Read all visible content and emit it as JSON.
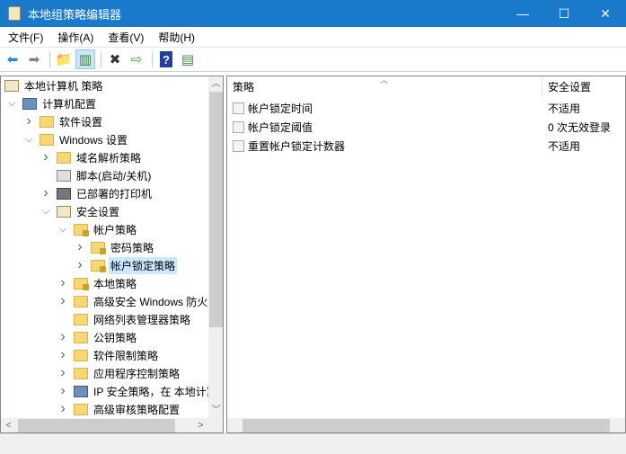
{
  "window": {
    "title": "本地组策略编辑器",
    "minimize": "—",
    "maximize": "☐",
    "close": "✕"
  },
  "menu": [
    "文件(F)",
    "操作(A)",
    "查看(V)",
    "帮助(H)"
  ],
  "toolbar": [
    {
      "name": "back-icon",
      "glyph": "⬅",
      "color": "#2b88d8"
    },
    {
      "name": "forward-icon",
      "glyph": "➡",
      "color": "#808080"
    },
    {
      "sep": true
    },
    {
      "name": "up-folder-icon",
      "glyph": "📁",
      "color": "#d8a030"
    },
    {
      "name": "show-hide-tree-icon",
      "glyph": "▥",
      "color": "#3a8a3a",
      "selected": true
    },
    {
      "sep": true
    },
    {
      "name": "delete-icon",
      "glyph": "✖",
      "color": "#333"
    },
    {
      "name": "export-list-icon",
      "glyph": "⇨",
      "color": "#3a9a3a"
    },
    {
      "sep": true
    },
    {
      "name": "help-icon",
      "glyph": "?",
      "color": "#2040a0"
    },
    {
      "name": "action-pane-icon",
      "glyph": "▤",
      "color": "#3a8a3a"
    }
  ],
  "tree": [
    {
      "label": "本地计算机 策略",
      "level": 0,
      "arrow": "",
      "icon": "doc"
    },
    {
      "label": "计算机配置",
      "level": 1,
      "arrow": "expanded",
      "icon": "comp"
    },
    {
      "label": "软件设置",
      "level": 2,
      "arrow": "collapsed",
      "icon": "folder"
    },
    {
      "label": "Windows 设置",
      "level": 2,
      "arrow": "expanded",
      "icon": "folder"
    },
    {
      "label": "域名解析策略",
      "level": 3,
      "arrow": "collapsed",
      "icon": "folder"
    },
    {
      "label": "脚本(启动/关机)",
      "level": 3,
      "arrow": "",
      "icon": "scroll-icon"
    },
    {
      "label": "已部署的打印机",
      "level": 3,
      "arrow": "collapsed",
      "icon": "printer"
    },
    {
      "label": "安全设置",
      "level": 3,
      "arrow": "expanded",
      "icon": "doc"
    },
    {
      "label": "帐户策略",
      "level": 4,
      "arrow": "expanded",
      "icon": "folder lock"
    },
    {
      "label": "密码策略",
      "level": 5,
      "arrow": "collapsed",
      "icon": "folder lock"
    },
    {
      "label": "帐户锁定策略",
      "level": 5,
      "arrow": "collapsed",
      "icon": "folder lock",
      "selected": true
    },
    {
      "label": "本地策略",
      "level": 4,
      "arrow": "collapsed",
      "icon": "folder lock"
    },
    {
      "label": "高级安全 Windows 防火墙",
      "level": 4,
      "arrow": "collapsed",
      "icon": "folder"
    },
    {
      "label": "网络列表管理器策略",
      "level": 4,
      "arrow": "",
      "icon": "folder"
    },
    {
      "label": "公钥策略",
      "level": 4,
      "arrow": "collapsed",
      "icon": "folder"
    },
    {
      "label": "软件限制策略",
      "level": 4,
      "arrow": "collapsed",
      "icon": "folder"
    },
    {
      "label": "应用程序控制策略",
      "level": 4,
      "arrow": "collapsed",
      "icon": "folder"
    },
    {
      "label": "IP 安全策略，在 本地计算机",
      "level": 4,
      "arrow": "collapsed",
      "icon": "comp"
    },
    {
      "label": "高级审核策略配置",
      "level": 4,
      "arrow": "collapsed",
      "icon": "folder"
    }
  ],
  "list": {
    "columns": [
      "策略",
      "安全设置"
    ],
    "rows": [
      {
        "policy": "帐户锁定时间",
        "setting": "不适用"
      },
      {
        "policy": "帐户锁定阈值",
        "setting": "0 次无效登录"
      },
      {
        "policy": "重置帐户锁定计数器",
        "setting": "不适用"
      }
    ]
  }
}
